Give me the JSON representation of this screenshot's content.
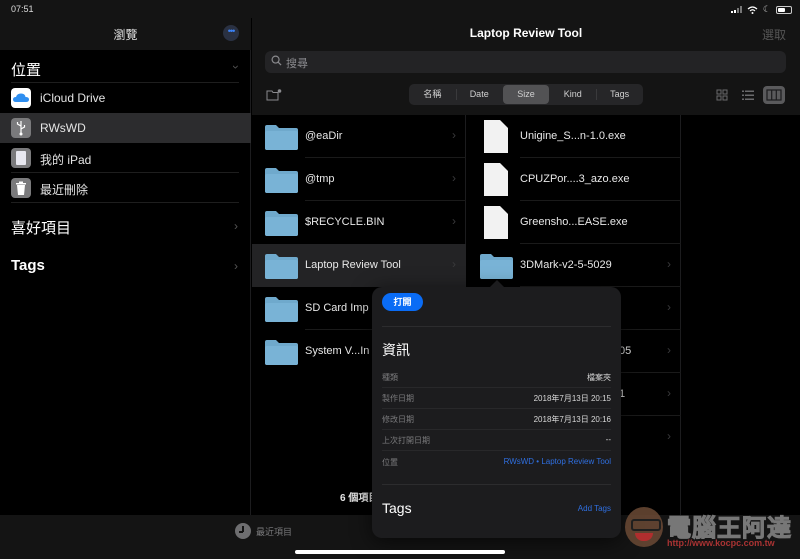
{
  "status_bar": {
    "time": "07:51",
    "signal_bars_active": 2,
    "signal_bars_total": 4,
    "battery_percent": 60
  },
  "sidebar": {
    "title": "瀏覽",
    "more_icon": "ellipsis-icon",
    "locations_header": "位置",
    "locations": [
      {
        "label": "iCloud Drive",
        "icon": "icloud-icon",
        "selected": false
      },
      {
        "label": "RWsWD",
        "icon": "usb-drive-icon",
        "selected": true
      },
      {
        "label": "我的 iPad",
        "icon": "ipad-icon",
        "selected": false
      },
      {
        "label": "最近刪除",
        "icon": "trash-icon",
        "selected": false
      }
    ],
    "favorites_header": "喜好項目",
    "tags_header": "Tags"
  },
  "main": {
    "title": "Laptop Review Tool",
    "select_label": "選取",
    "search_placeholder": "搜尋",
    "sort_segments": [
      {
        "label": "名稱",
        "selected": false
      },
      {
        "label": "Date",
        "selected": false
      },
      {
        "label": "Size",
        "selected": true
      },
      {
        "label": "Kind",
        "selected": false
      },
      {
        "label": "Tags",
        "selected": false
      }
    ],
    "view_modes": [
      {
        "name": "icon-grid-view",
        "selected": false
      },
      {
        "name": "list-view",
        "selected": false
      },
      {
        "name": "column-view",
        "selected": true
      }
    ],
    "column1": [
      {
        "name": "@eaDir",
        "type": "folder",
        "selected": false
      },
      {
        "name": "@tmp",
        "type": "folder",
        "selected": false
      },
      {
        "name": "$RECYCLE.BIN",
        "type": "folder",
        "selected": false
      },
      {
        "name": "Laptop Review Tool",
        "type": "folder",
        "selected": true
      },
      {
        "name": "SD Card Imp",
        "type": "folder",
        "selected": false
      },
      {
        "name": "System V...In",
        "type": "folder",
        "selected": false
      }
    ],
    "column2": [
      {
        "name": "Unigine_S...n-1.0.exe",
        "type": "file"
      },
      {
        "name": "CPUZPor....3_azo.exe",
        "type": "file"
      },
      {
        "name": "Greensho...EASE.exe",
        "type": "file"
      },
      {
        "name": "3DMark-v2-5-5029",
        "type": "folder"
      },
      {
        "name": "",
        "type": "folder"
      },
      {
        "name": "05",
        "type": "folder"
      },
      {
        "name": "1",
        "type": "folder"
      },
      {
        "name": "",
        "type": "folder"
      }
    ],
    "item_count": "6 個項目"
  },
  "popover": {
    "open_label": "打開",
    "info_title": "資訊",
    "rows": [
      {
        "key": "種類",
        "value": "檔案夾",
        "link": false
      },
      {
        "key": "製作日期",
        "value": "2018年7月13日 20:15",
        "link": false
      },
      {
        "key": "修改日期",
        "value": "2018年7月13日 20:16",
        "link": false
      },
      {
        "key": "上次打開日期",
        "value": "--",
        "link": false
      },
      {
        "key": "位置",
        "value": "RWsWD • Laptop Review Tool",
        "link": true
      }
    ],
    "tags_title": "Tags",
    "add_tags_label": "Add Tags"
  },
  "tab_bar": {
    "recent_label": "最近項目"
  },
  "watermark": {
    "text": "電腦王阿達",
    "url": "http://www.kocpc.com.tw"
  },
  "colors": {
    "accent": "#0a6cf5",
    "link": "#2f6fe0",
    "folder": "#6fa9cc"
  }
}
